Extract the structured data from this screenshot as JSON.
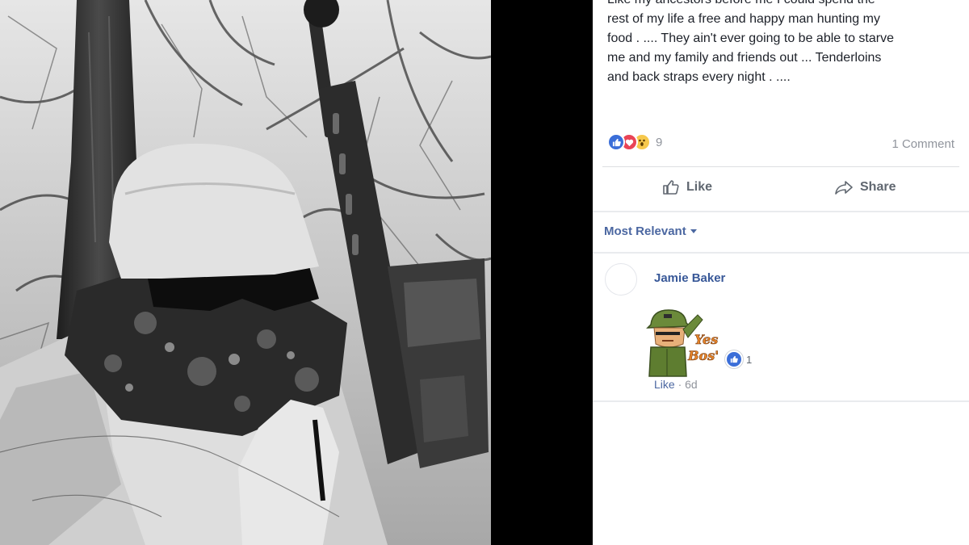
{
  "post": {
    "text_lines": [
      "Like my ancestors before me I could spend the",
      "rest of my life a free and happy man hunting my",
      "food . .... They ain't ever going to be able to starve",
      "me and my family and friends out ... Tenderloins",
      "and back straps every night . ...."
    ],
    "reactions": {
      "icons": [
        "like-icon",
        "love-icon",
        "wow-icon"
      ],
      "count": "9"
    },
    "comment_count": "1 Comment"
  },
  "actions": {
    "like_label": "Like",
    "share_label": "Share"
  },
  "comments_sort": {
    "label": "Most Relevant"
  },
  "comment": {
    "author": "Jamie Baker",
    "sticker": {
      "icon": "saluting-soldier-sticker",
      "text_line1": "Yes",
      "text_line2": "Bos'"
    },
    "reaction_count": "1",
    "like_label": "Like",
    "separator": "·",
    "time": "6d"
  },
  "colors": {
    "link": "#385898",
    "muted": "#90949c",
    "like_blue": "#3b6ed8",
    "love_red": "#e94456"
  }
}
